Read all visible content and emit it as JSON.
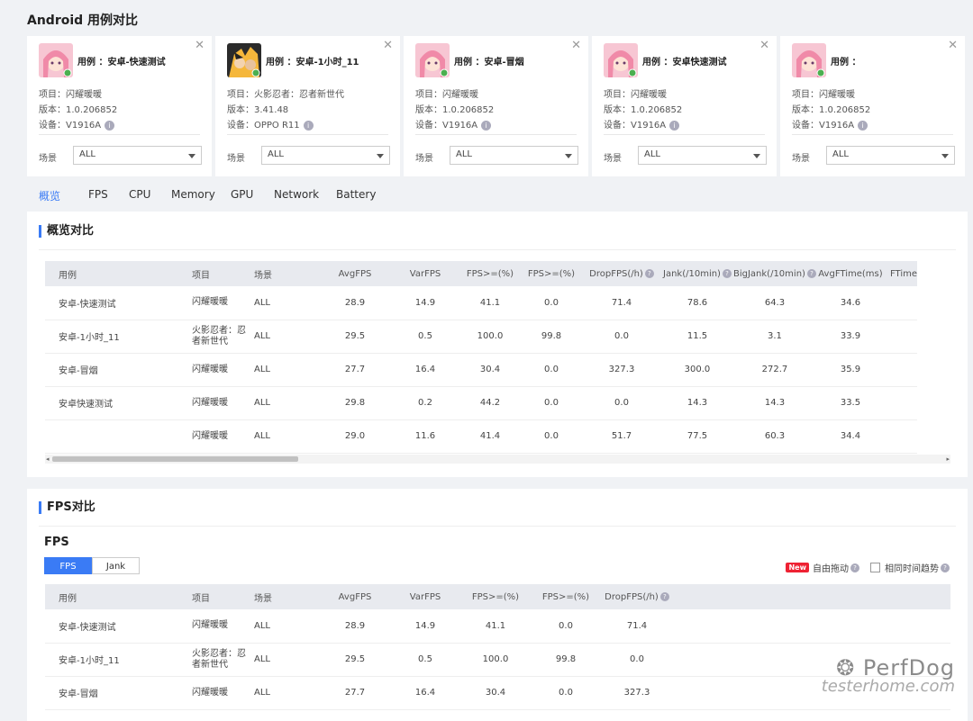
{
  "page": {
    "title": "Android 用例对比"
  },
  "cards": [
    {
      "case_label": "用例 ：安卓-快速测试",
      "project": "项目：闪耀暖暖",
      "version": "版本：1.0.206852",
      "device": "设备：V1916A",
      "scene_label": "场景",
      "scene_value": "ALL",
      "avatar": "anime-girl-pink"
    },
    {
      "case_label": "用例 ：安卓-1小时_11",
      "project": "项目：火影忍者：忍者新世代",
      "version": "版本：3.41.48",
      "device": "设备：OPPO R11",
      "scene_label": "场景",
      "scene_value": "ALL",
      "avatar": "ninja-characters"
    },
    {
      "case_label": "用例 ：安卓-冒烟",
      "project": "项目：闪耀暖暖",
      "version": "版本：1.0.206852",
      "device": "设备：V1916A",
      "scene_label": "场景",
      "scene_value": "ALL",
      "avatar": "anime-girl-pink"
    },
    {
      "case_label": "用例 ：安卓快速测试",
      "project": "项目：闪耀暖暖",
      "version": "版本：1.0.206852",
      "device": "设备：V1916A",
      "scene_label": "场景",
      "scene_value": "ALL",
      "avatar": "anime-girl-pink"
    },
    {
      "case_label": "用例 ：",
      "project": "项目：闪耀暖暖",
      "version": "版本：1.0.206852",
      "device": "设备：V1916A",
      "scene_label": "场景",
      "scene_value": "ALL",
      "avatar": "anime-girl-pink"
    }
  ],
  "tabs": [
    "概览",
    "FPS",
    "CPU",
    "Memory",
    "GPU",
    "Network",
    "Battery"
  ],
  "active_tab": "概览",
  "overview": {
    "title": "概览对比",
    "columns": [
      "用例",
      "项目",
      "场景",
      "AvgFPS",
      "VarFPS",
      "FPS>=(%)",
      "FPS>=(%)",
      "DropFPS(/h)",
      "Jank(/10min)",
      "BigJank(/10min)",
      "AvgFTime(ms)",
      "FTime"
    ],
    "rows": [
      [
        "安卓-快速测试",
        "闪耀暖暖",
        "ALL",
        "28.9",
        "14.9",
        "41.1",
        "0.0",
        "71.4",
        "78.6",
        "64.3",
        "34.6"
      ],
      [
        "安卓-1小时_11",
        "火影忍者：忍者新世代",
        "ALL",
        "29.5",
        "0.5",
        "100.0",
        "99.8",
        "0.0",
        "11.5",
        "3.1",
        "33.9"
      ],
      [
        "安卓-冒烟",
        "闪耀暖暖",
        "ALL",
        "27.7",
        "16.4",
        "30.4",
        "0.0",
        "327.3",
        "300.0",
        "272.7",
        "35.9"
      ],
      [
        "安卓快速测试",
        "闪耀暖暖",
        "ALL",
        "29.8",
        "0.2",
        "44.2",
        "0.0",
        "0.0",
        "14.3",
        "14.3",
        "33.5"
      ],
      [
        "",
        "闪耀暖暖",
        "ALL",
        "29.0",
        "11.6",
        "41.4",
        "0.0",
        "51.7",
        "77.5",
        "60.3",
        "34.4"
      ]
    ]
  },
  "fps": {
    "title": "FPS对比",
    "subtitle": "FPS",
    "toggle_on": "FPS",
    "toggle_off": "Jank",
    "new_badge": "New",
    "free_drag": "自由拖动",
    "same_time_trend": "相同时间趋势",
    "columns": [
      "用例",
      "项目",
      "场景",
      "AvgFPS",
      "VarFPS",
      "FPS>=(%)",
      "FPS>=(%)",
      "DropFPS(/h)"
    ],
    "rows": [
      [
        "安卓-快速测试",
        "闪耀暖暖",
        "ALL",
        "28.9",
        "14.9",
        "41.1",
        "0.0",
        "71.4"
      ],
      [
        "安卓-1小时_11",
        "火影忍者：忍者新世代",
        "ALL",
        "29.5",
        "0.5",
        "100.0",
        "99.8",
        "0.0"
      ],
      [
        "安卓-冒烟",
        "闪耀暖暖",
        "ALL",
        "27.7",
        "16.4",
        "30.4",
        "0.0",
        "327.3"
      ]
    ]
  },
  "watermark": {
    "brand": "PerfDog",
    "site": "testerhome.com"
  },
  "colors": {
    "accent": "#3a7bf5",
    "new_badge": "#e23333",
    "header_bg": "#e8eaef"
  }
}
